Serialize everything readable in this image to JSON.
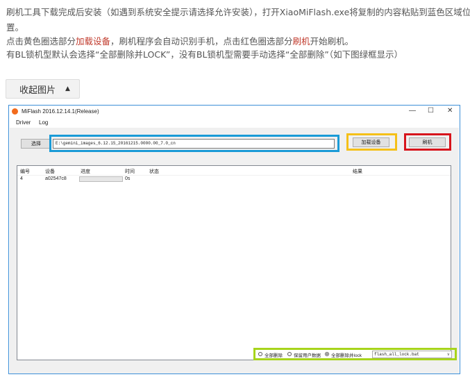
{
  "instructions": {
    "line1": "刷机工具下载完成后安装（如遇到系统安全提示请选择允许安装），打开XiaoMiFlash.exe将复制的内容粘贴到蓝色区域位",
    "line2": "置。",
    "line3_a": "点击黄色圈选部分",
    "line3_h1": "加载设备",
    "line3_b": "，刷机程序会自动识别手机，点击红色圈选部分",
    "line3_h2": "刷机",
    "line3_c": "开始刷机。",
    "line4": "有BL锁机型默认会选择“全部删除并LOCK”，没有BL锁机型需要手动选择“全部删除”（如下图绿框显示）"
  },
  "collapse_button": {
    "label": "收起图片",
    "icon": "triangle-up-icon"
  },
  "window": {
    "title": "MiFlash 2016.12.14.1(Release)",
    "controls": {
      "minimize": "—",
      "maximize": "☐",
      "close": "✕"
    },
    "menu": [
      "Driver",
      "Log"
    ],
    "select_button": "选择",
    "path_value": "E:\\gemini_images_6.12.15_20161215.0000.00_7.0_cn",
    "load_device_button": "加载设备",
    "flash_button": "刷机",
    "table": {
      "headers": [
        "编号",
        "设备",
        "进度",
        "时间",
        "状态",
        "结果"
      ],
      "rows": [
        {
          "id": "4",
          "device": "a02547c8",
          "progress": 0,
          "time": "0s",
          "status": "",
          "result": ""
        }
      ]
    },
    "options": {
      "radios": [
        {
          "label": "全部删除",
          "checked": false
        },
        {
          "label": "保留用户数据",
          "checked": false
        },
        {
          "label": "全部删除并lock",
          "checked": true
        }
      ],
      "script": "flash_all_lock.bat"
    }
  },
  "highlight_colors": {
    "blue": "#1a9bd7",
    "yellow": "#f5c018",
    "red": "#d7141c",
    "green": "#a7d41b"
  }
}
